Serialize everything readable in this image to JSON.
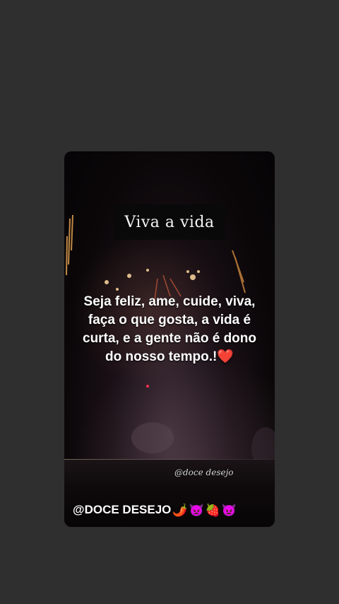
{
  "story": {
    "title": "Viva a vida",
    "quote": "Seja feliz, ame, cuide, viva, faça o que gosta, a vida é curta, e a gente não é dono do nosso tempo.!",
    "quote_emoji": "❤️",
    "watermark": "@doce desejo",
    "footer_label": "@DOCE DESEJO",
    "footer_emojis": [
      "🌶️",
      "👿",
      "🍓",
      "👿"
    ]
  },
  "colors": {
    "background": "#2f2f2f",
    "title_box": "#0a0a0a",
    "heart": "#e01630"
  }
}
